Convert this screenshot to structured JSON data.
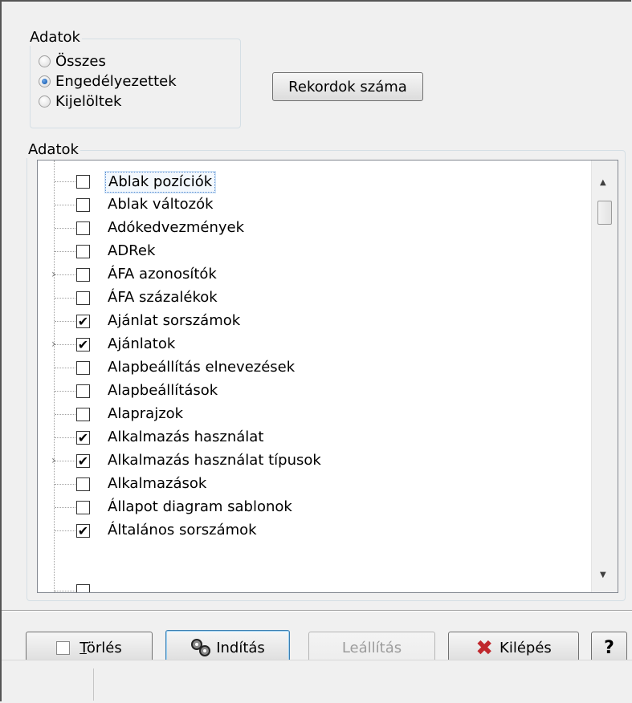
{
  "filter_group": {
    "legend": "Adatok",
    "options": [
      {
        "label": "Összes",
        "selected": false
      },
      {
        "label": "Engedélyezettek",
        "selected": true
      },
      {
        "label": "Kijelöltek",
        "selected": false
      }
    ]
  },
  "count_button": {
    "label": "Rekordok száma"
  },
  "data_group": {
    "legend": "Adatok",
    "items": [
      {
        "label": "Ablak pozíciók",
        "checked": false,
        "expandable": false,
        "focused": true
      },
      {
        "label": "Ablak változók",
        "checked": false,
        "expandable": false
      },
      {
        "label": "Adókedvezmények",
        "checked": false,
        "expandable": false
      },
      {
        "label": "ADRek",
        "checked": false,
        "expandable": false
      },
      {
        "label": "ÁFA azonosítók",
        "checked": false,
        "expandable": true
      },
      {
        "label": "ÁFA százalékok",
        "checked": false,
        "expandable": false
      },
      {
        "label": "Ajánlat sorszámok",
        "checked": true,
        "expandable": false
      },
      {
        "label": "Ajánlatok",
        "checked": true,
        "expandable": true
      },
      {
        "label": "Alapbeállítás elnevezések",
        "checked": false,
        "expandable": false
      },
      {
        "label": "Alapbeállítások",
        "checked": false,
        "expandable": false
      },
      {
        "label": "Alaprajzok",
        "checked": false,
        "expandable": false
      },
      {
        "label": "Alkalmazás használat",
        "checked": true,
        "expandable": false
      },
      {
        "label": "Alkalmazás használat típusok",
        "checked": true,
        "expandable": true
      },
      {
        "label": "Alkalmazások",
        "checked": false,
        "expandable": false
      },
      {
        "label": "Állapot diagram sablonok",
        "checked": false,
        "expandable": false
      },
      {
        "label": "Általános sorszámok",
        "checked": true,
        "expandable": false
      }
    ]
  },
  "buttons": {
    "delete": {
      "label": "Törlés",
      "mnemonic": "T"
    },
    "start": {
      "label": "Indítás"
    },
    "stop": {
      "label": "Leállítás"
    },
    "exit": {
      "label": "Kilépés"
    },
    "help": {
      "label": "?"
    }
  },
  "colors": {
    "exit_icon": "#c0282d",
    "focus_border": "#3c7fb1"
  }
}
